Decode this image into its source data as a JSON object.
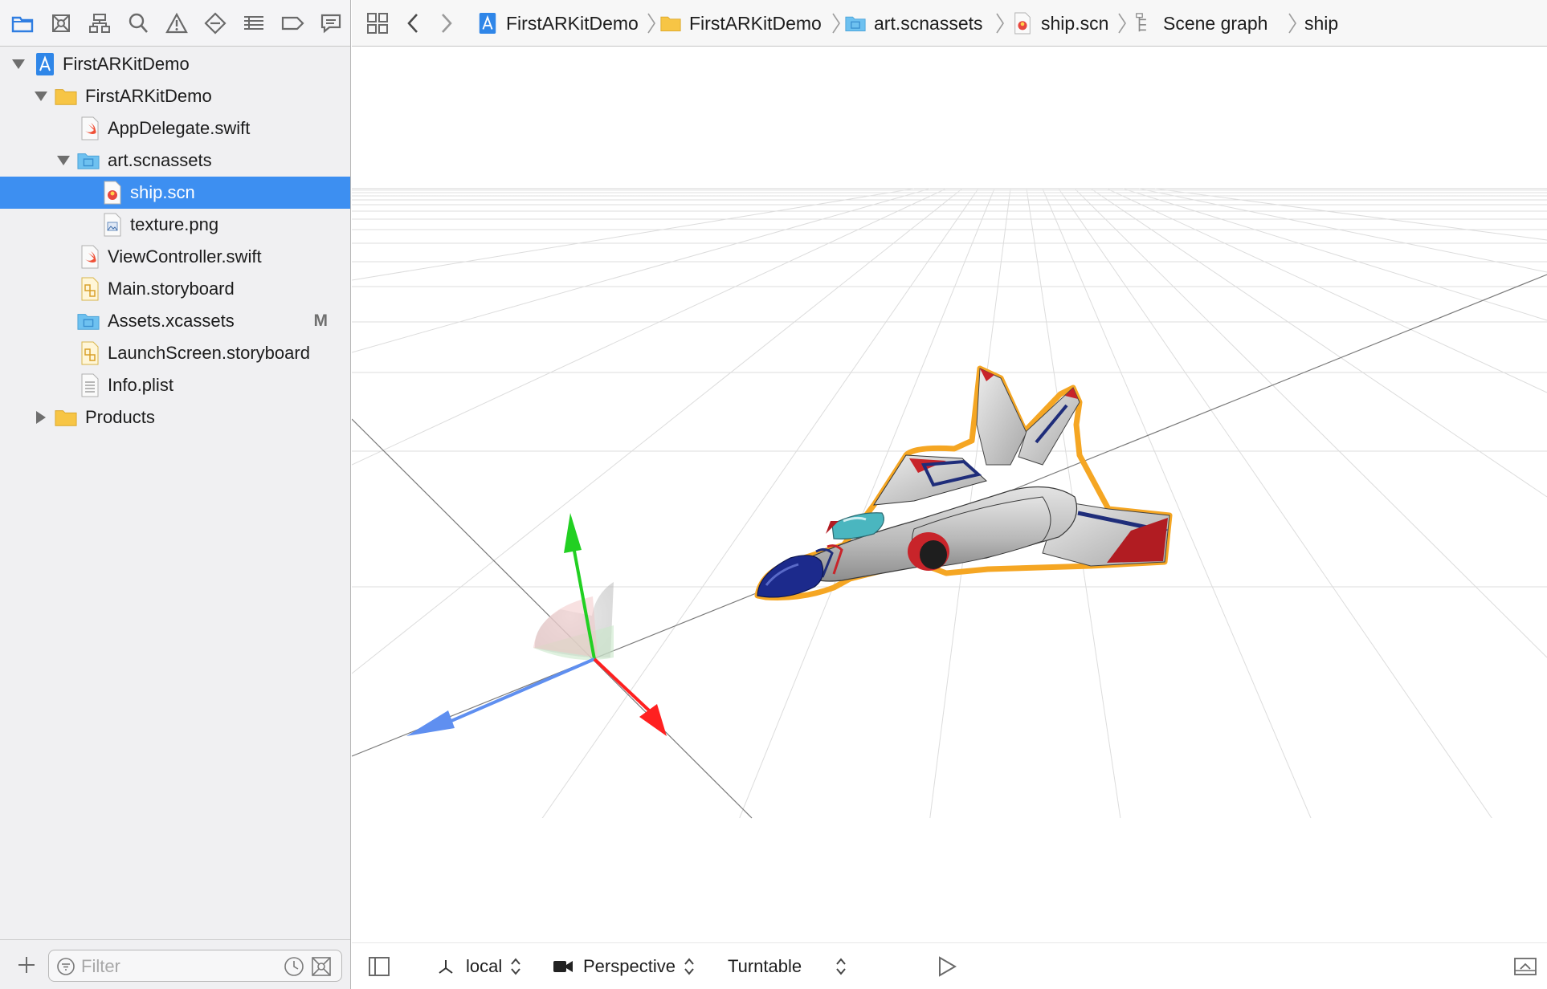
{
  "navigator": {
    "toolbar_icons": [
      "folder-icon",
      "source-control-icon",
      "hierarchy-icon",
      "search-icon",
      "warning-icon",
      "test-diamond-icon",
      "debug-list-icon",
      "breakpoint-icon",
      "report-icon"
    ],
    "tree": [
      {
        "label": "FirstARKitDemo",
        "icon": "project-icon",
        "expanded": true
      },
      {
        "label": "FirstARKitDemo",
        "icon": "folder-icon",
        "expanded": true
      },
      {
        "label": "AppDelegate.swift",
        "icon": "swift-file-icon"
      },
      {
        "label": "art.scnassets",
        "icon": "blue-folder-icon",
        "expanded": true
      },
      {
        "label": "ship.scn",
        "icon": "scene-file-icon",
        "selected": true
      },
      {
        "label": "texture.png",
        "icon": "image-file-icon"
      },
      {
        "label": "ViewController.swift",
        "icon": "swift-file-icon"
      },
      {
        "label": "Main.storyboard",
        "icon": "storyboard-icon"
      },
      {
        "label": "Assets.xcassets",
        "icon": "blue-folder-icon",
        "badge": "M"
      },
      {
        "label": "LaunchScreen.storyboard",
        "icon": "storyboard-icon"
      },
      {
        "label": "Info.plist",
        "icon": "plist-icon"
      },
      {
        "label": "Products",
        "icon": "folder-icon",
        "expanded": false
      }
    ],
    "filter": {
      "placeholder": "Filter",
      "value": ""
    }
  },
  "jumpbar": {
    "crumbs": [
      {
        "label": "FirstARKitDemo",
        "icon": "project-icon"
      },
      {
        "label": "FirstARKitDemo",
        "icon": "folder-icon"
      },
      {
        "label": "art.scnassets",
        "icon": "blue-folder-icon"
      },
      {
        "label": "ship.scn",
        "icon": "scene-file-icon"
      },
      {
        "label": "Scene graph",
        "icon": "scene-graph-icon"
      },
      {
        "label": "ship",
        "icon": ""
      }
    ]
  },
  "scene_toolbar": {
    "transform_mode": "local",
    "camera": "Perspective",
    "navigation": "Turntable"
  },
  "colors": {
    "selection": "#3d8ff1",
    "accent_blue": "#2f7de1",
    "folder_yellow": "#f7c545",
    "folder_blue": "#6ec1f0",
    "ship_outline": "#f5a623",
    "axis_x": "#ff2020",
    "axis_y": "#20d020",
    "axis_z": "#5f8ff0"
  }
}
